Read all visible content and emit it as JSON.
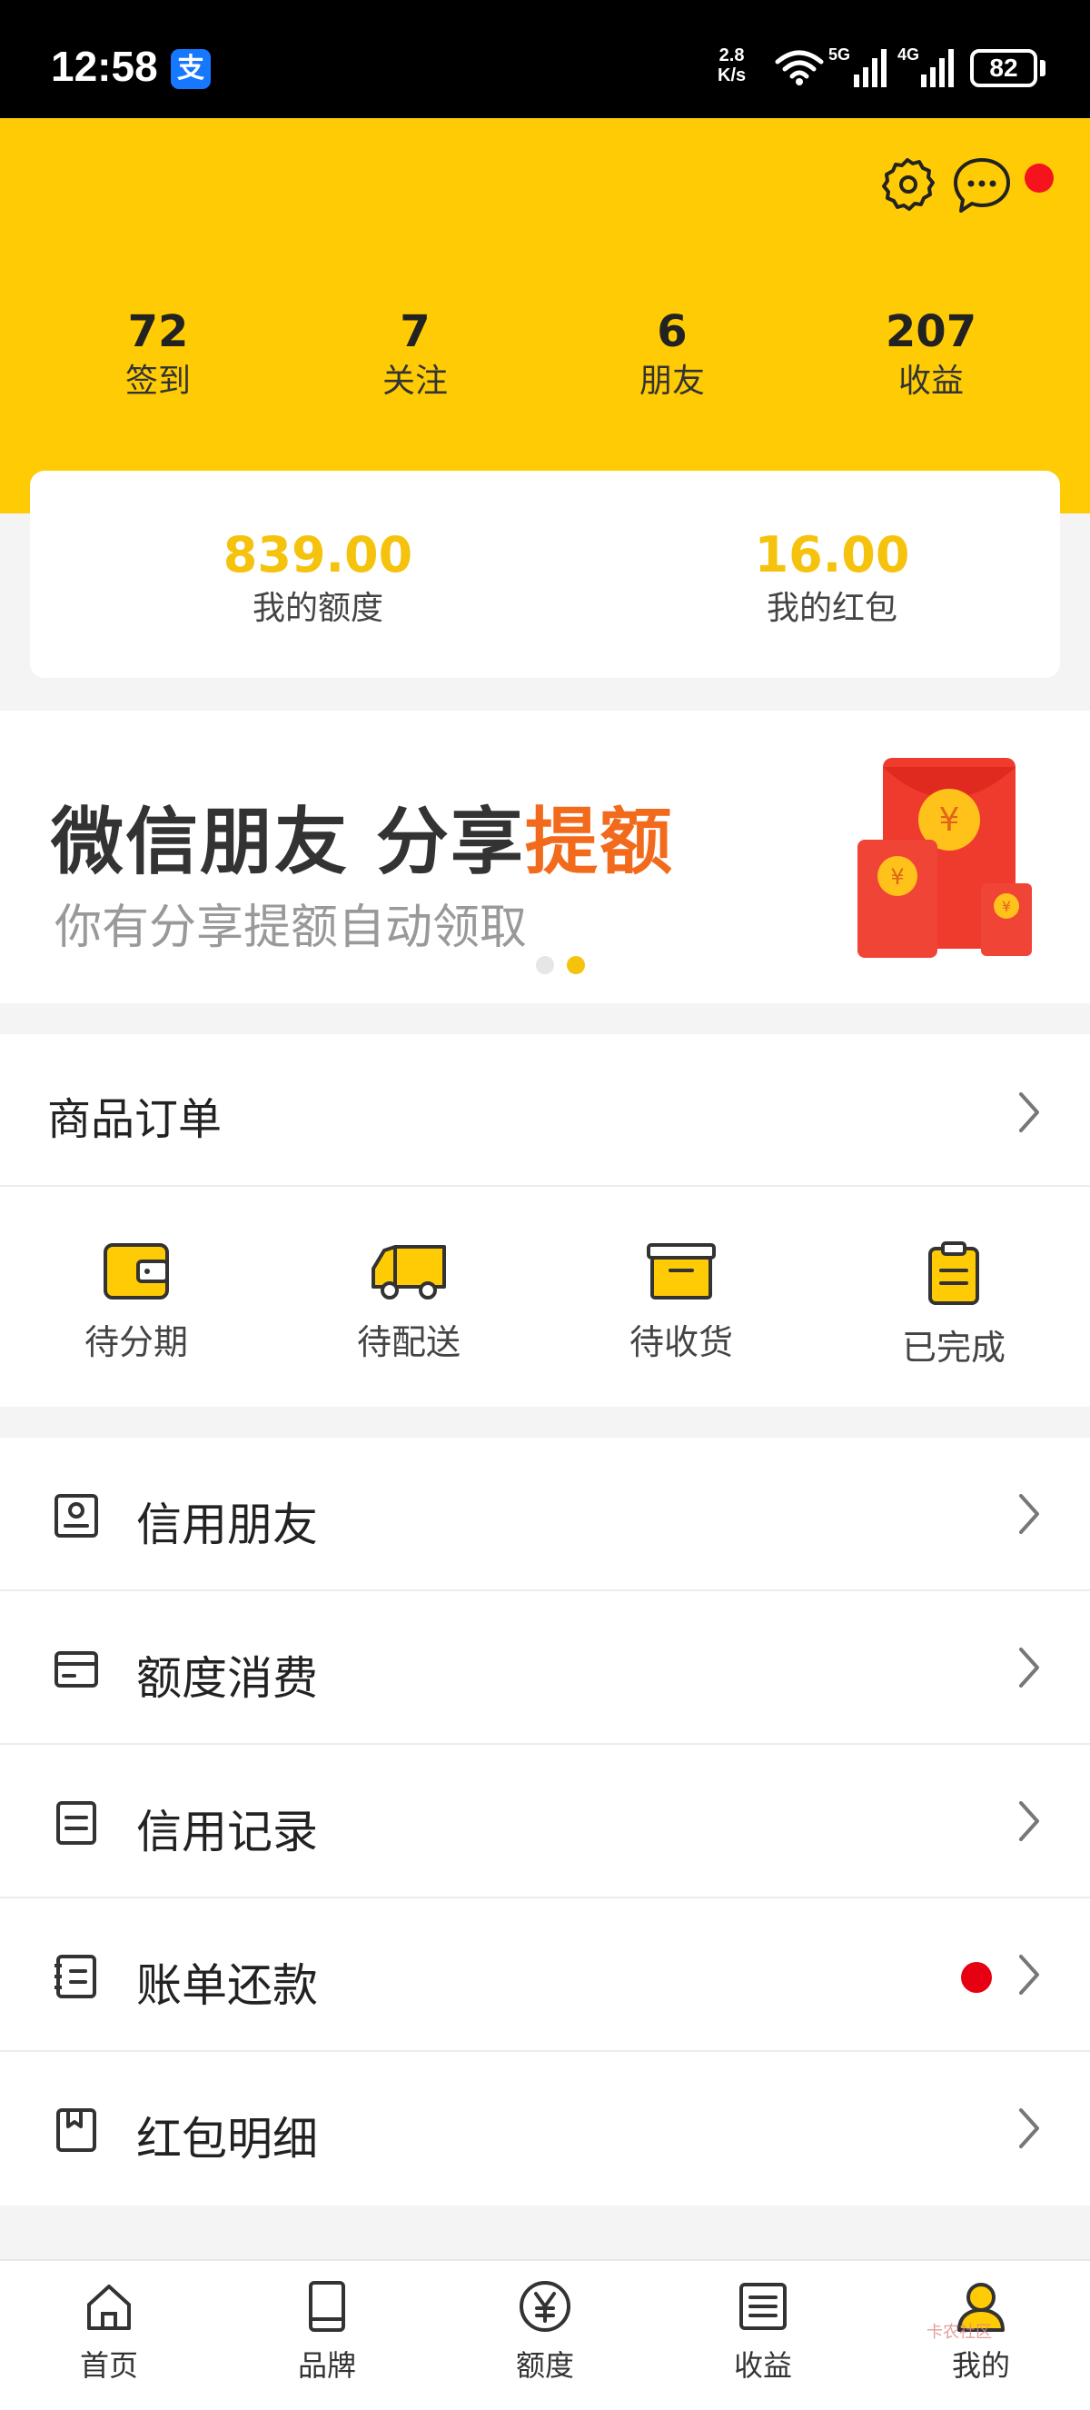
{
  "status_bar": {
    "time": "12:58",
    "alipay_badge": "支",
    "speed_value": "2.8",
    "speed_unit": "K/s",
    "net1": "5G",
    "net2": "4G",
    "battery": "82"
  },
  "header": {
    "stats": [
      {
        "value": "72",
        "label": "签到"
      },
      {
        "value": "7",
        "label": "关注"
      },
      {
        "value": "6",
        "label": "朋友"
      },
      {
        "value": "207",
        "label": "收益"
      }
    ]
  },
  "balance": {
    "credit_value": "839.00",
    "credit_label": "我的额度",
    "redpacket_value": "16.00",
    "redpacket_label": "我的红包"
  },
  "banner": {
    "title_main": "微信朋友 分享",
    "title_highlight": "提额",
    "subtitle": "你有分享提额自动领取",
    "art_symbol": "¥"
  },
  "orders": {
    "title": "商品订单",
    "statuses": [
      {
        "label": "待分期",
        "icon": "wallet-icon"
      },
      {
        "label": "待配送",
        "icon": "truck-icon"
      },
      {
        "label": "待收货",
        "icon": "box-icon"
      },
      {
        "label": "已完成",
        "icon": "clipboard-icon"
      }
    ]
  },
  "menu": {
    "items": [
      {
        "label": "信用朋友",
        "icon": "contact-card-icon"
      },
      {
        "label": "额度消费",
        "icon": "credit-card-icon"
      },
      {
        "label": "信用记录",
        "icon": "document-icon"
      },
      {
        "label": "账单还款",
        "icon": "bill-icon",
        "has_dot": true
      },
      {
        "label": "红包明细",
        "icon": "bookmark-icon"
      }
    ]
  },
  "tabbar": {
    "tabs": [
      {
        "label": "首页",
        "icon": "home-icon"
      },
      {
        "label": "品牌",
        "icon": "book-icon"
      },
      {
        "label": "额度",
        "icon": "yen-icon"
      },
      {
        "label": "收益",
        "icon": "list-icon"
      },
      {
        "label": "我的",
        "icon": "user-icon",
        "active": true
      }
    ]
  },
  "watermark": "卡农社区",
  "colors": {
    "brand_yellow": "#ffcb05",
    "amount_yellow": "#f5c20d",
    "highlight_orange": "#f26a1b",
    "alert_red": "#e60012"
  }
}
